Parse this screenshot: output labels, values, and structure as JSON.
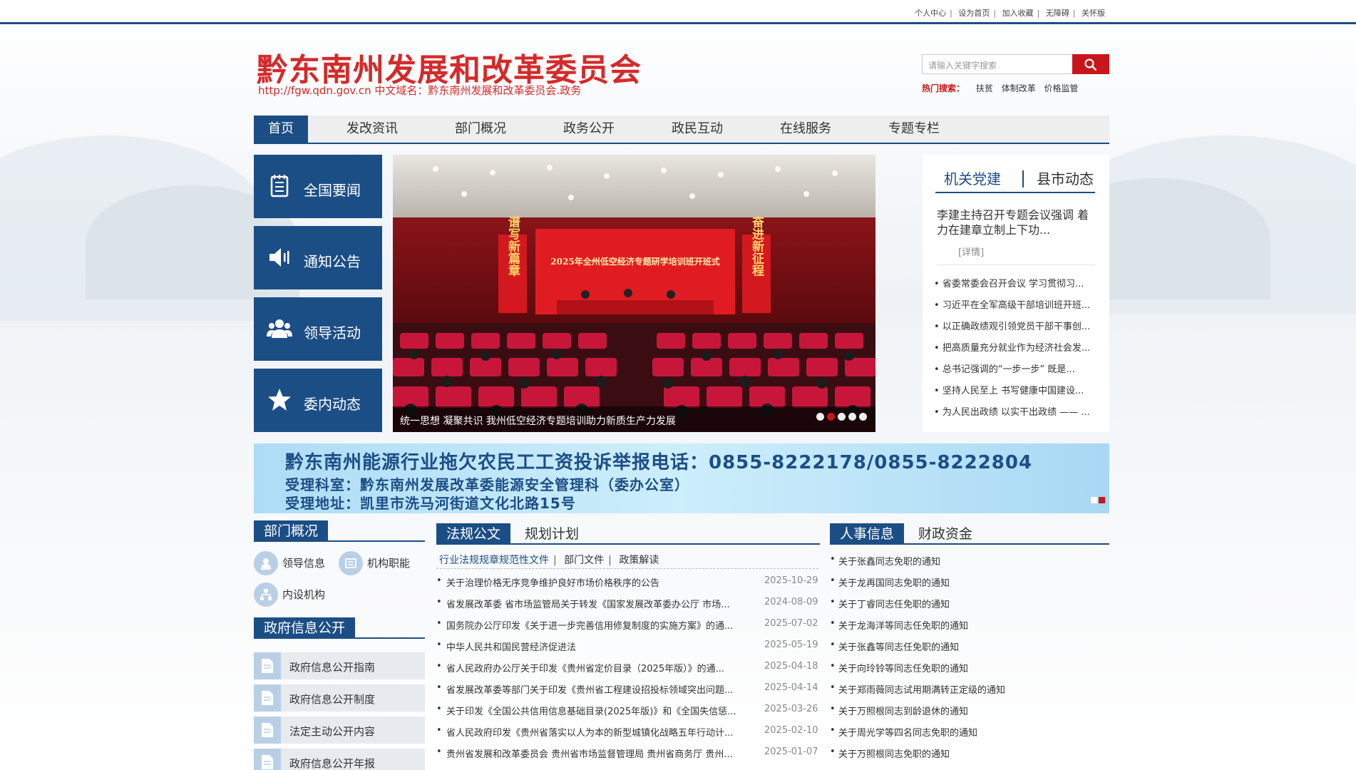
{
  "top_links": [
    "个人中心",
    "设为首页",
    "加入收藏",
    "无障碍",
    "关怀版"
  ],
  "site": {
    "title": "黔东南州发展和改革委员会",
    "subtitle": "http://fgw.qdn.gov.cn 中文域名：黔东南州发展和改革委员会.政务"
  },
  "search": {
    "placeholder": "请输入关键字搜索",
    "hot_label": "热门搜索：",
    "hot_terms": [
      "扶贫",
      "体制改革",
      "价格监管"
    ]
  },
  "nav": [
    "首页",
    "发改资讯",
    "部门概况",
    "政务公开",
    "政民互动",
    "在线服务",
    "专题专栏"
  ],
  "quick_links": [
    {
      "label": "全国要闻",
      "icon": "notepad-icon"
    },
    {
      "label": "通知公告",
      "icon": "speaker-icon"
    },
    {
      "label": "领导活动",
      "icon": "people-icon"
    },
    {
      "label": "委内动态",
      "icon": "star-icon"
    }
  ],
  "slider": {
    "caption": "统一思想 凝聚共识 我州低空经济专题培训助力新质生产力发展",
    "slide_count": 5,
    "active_index": 1,
    "stage_banner": "2025年全州低空经济专题研学培训班开班式",
    "left_banner": "谱写新篇章",
    "right_banner": "奋进新征程"
  },
  "party": {
    "tabs": [
      "机关党建",
      "县市动态"
    ],
    "headline": "李建主持召开专题会议强调 着力在建章立制上下功...",
    "detail": "[详情]",
    "items": [
      "省委常委会召开会议 学习贯彻习...",
      "习近平在全军高级干部培训班开班...",
      "以正确政绩观引领党员干部干事创...",
      "把高质量充分就业作为经济社会发...",
      "总书记强调的“一步一步” 既是...",
      "坚持人民至上 书写健康中国建设...",
      "为人民出政绩 以实干出政绩 —— ..."
    ]
  },
  "banner": {
    "line1": "黔东南州能源行业拖欠农民工工资投诉举报电话：0855-8222178/0855-8222804",
    "line2": "受理科室：黔东南州发展改革委能源安全管理科（委办公室）",
    "line3": "受理地址：凯里市洗马河街道文化北路15号"
  },
  "dept": {
    "title": "部门概况",
    "items": [
      "领导信息",
      "机构职能",
      "内设机构"
    ]
  },
  "gov_info": {
    "title": "政府信息公开",
    "items": [
      "政府信息公开指南",
      "政府信息公开制度",
      "法定主动公开内容",
      "政府信息公开年报"
    ]
  },
  "laws": {
    "tab_active": "法规公文",
    "tab_other": "规划计划",
    "subtabs": [
      "行业法规规章规范性文件",
      "部门文件",
      "政策解读"
    ],
    "items": [
      {
        "title": "关于治理价格无序竞争维护良好市场价格秩序的公告",
        "date": "2025-10-29"
      },
      {
        "title": "省发展改革委 省市场监管局关于转发《国家发展改革委办公厅 市场...",
        "date": "2024-08-09"
      },
      {
        "title": "国务院办公厅印发《关于进一步完善信用修复制度的实施方案》的通...",
        "date": "2025-07-02"
      },
      {
        "title": "中华人民共和国民营经济促进法",
        "date": "2025-05-19"
      },
      {
        "title": "省人民政府办公厅关于印发《贵州省定价目录（2025年版）》的通...",
        "date": "2025-04-18"
      },
      {
        "title": "省发展改革委等部门关于印发《贵州省工程建设招投标领域突出问题...",
        "date": "2025-04-14"
      },
      {
        "title": "关于印发《全国公共信用信息基础目录(2025年版)》和《全国失信惩...",
        "date": "2025-03-26"
      },
      {
        "title": "省人民政府印发《贵州省落实以人为本的新型城镇化战略五年行动计...",
        "date": "2025-02-10"
      },
      {
        "title": "贵州省发展和改革委员会 贵州省市场监督管理局 贵州省商务厅 贵州...",
        "date": "2025-01-07"
      }
    ]
  },
  "hr": {
    "tab_active": "人事信息",
    "tab_other": "财政资金",
    "items": [
      "关于张鑫同志免职的通知",
      "关于龙再国同志免职的通知",
      "关于丁睿同志任免职的通知",
      "关于龙海洋等同志任免职的通知",
      "关于张鑫等同志任免职的通知",
      "关于向玲铃等同志任免职的通知",
      "关于郑雨薇同志试用期满转正定级的通知",
      "关于万照根同志到龄退休的通知",
      "关于周光学等四名同志免职的通知",
      "关于万照根同志免职的通知"
    ]
  },
  "colors": {
    "brand_blue": "#1c4e86",
    "brand_red": "#c8161d",
    "title_red": "#d42a2a"
  }
}
